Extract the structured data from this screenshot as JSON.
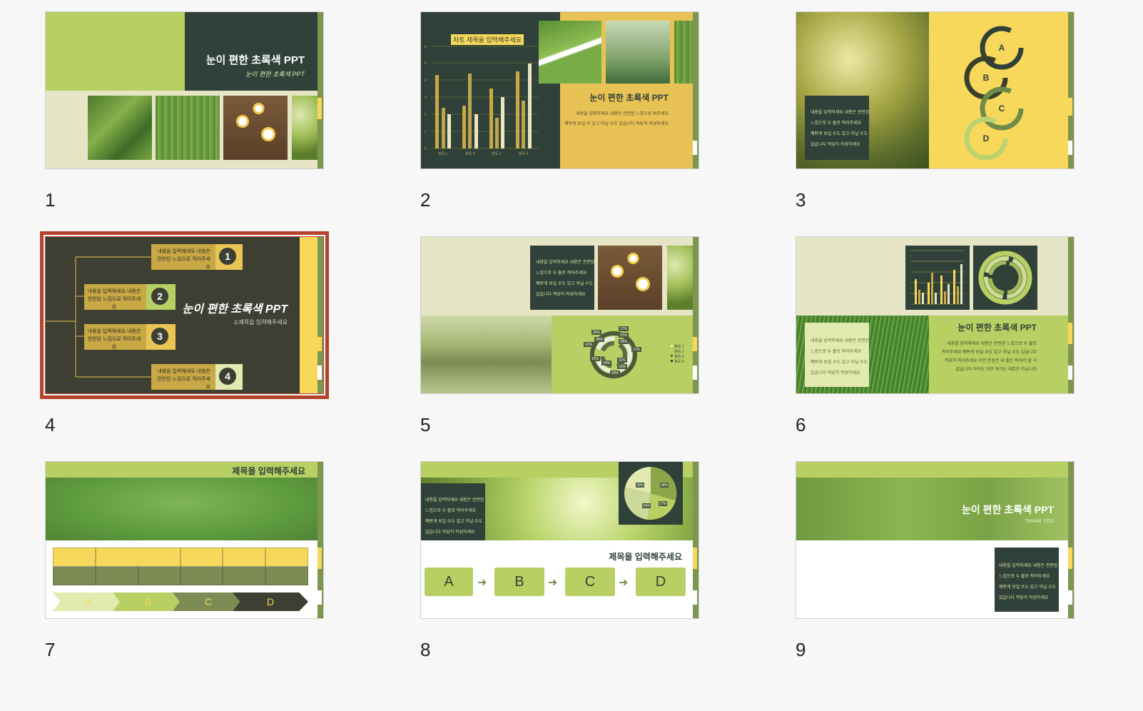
{
  "slides": [
    {
      "number": "1",
      "title": "눈이 편한 초록색 PPT",
      "subtitle": "눈이 편한 초록색 PPT"
    },
    {
      "number": "2",
      "chart_title": "차트 제목을 입력해주세요",
      "title": "눈이 편한 초록색 PPT",
      "body_lines": [
        "내용을 입력하세요 내용은 관련된 느낌으로 써주세요",
        "예쁘게 보일 수 있고 아닐 수도 있습니다 적당히 작성하세요"
      ],
      "y_ticks": [
        "6",
        "5",
        "4",
        "3",
        "2",
        "1",
        "0"
      ],
      "categories": [
        "항목 1",
        "항목 2",
        "항목 3",
        "항목 4"
      ]
    },
    {
      "number": "3",
      "cycle": [
        "A",
        "B",
        "C",
        "D"
      ],
      "body_lines": [
        "내용을 입력하세요 내용은 관련된",
        "느낌으로 두 줄로 적어주세요",
        "예쁘게 보일 수도 있고 아닐 수도",
        "있습니다 적당히 작성하세요"
      ]
    },
    {
      "number": "4",
      "title": "눈이 편한 초록색 PPT",
      "subtitle": "소제목을 입력해주세요",
      "items": [
        {
          "n": "1",
          "text": "내용을 입력해세요 내용은 관련된 느낌으로 적어주세요"
        },
        {
          "n": "2",
          "text": "내용을 입력해세요 내용은 관련된 느낌으로 적어주세요"
        },
        {
          "n": "3",
          "text": "내용을 입력해세요 내용은 관련된 느낌으로 적어주세요"
        },
        {
          "n": "4",
          "text": "내용을 입력해세요 내용은 관련된 느낌으로 적어주세요"
        }
      ]
    },
    {
      "number": "5",
      "body_lines": [
        "내용을 입력하세요 내용은 관련된",
        "느낌으로 두 줄로 적어주세요",
        "예쁘게 보일 수도 있고 아닐 수도",
        "있습니다 적당히 작성하세요"
      ],
      "donut_labels": [
        "24%",
        "30%",
        "17%",
        "21%",
        "29%",
        "17%",
        "41%",
        "16%",
        "24%",
        "11%",
        "19%",
        "25%"
      ],
      "legend": [
        "항목 1",
        "항목 2",
        "항목 3",
        "항목 4"
      ]
    },
    {
      "number": "6",
      "title": "눈이 편한 초록색 PPT",
      "body_lines": [
        "내용을 입력해세요 내용은 관련된 느낌으로 두 줄로",
        "적어주세요 예쁘게 보일 수도 있고 아닐 수도 있습니다",
        "적당히 적어주세요 이런 문장은 내 좋은 적어야 할 거",
        "같습니다 이야도 다만 여기는 대본은 아닙니다"
      ],
      "box_lines": [
        "내용을 입력하세요 내용은 관련된",
        "느낌으로 두 줄로 적어주세요",
        "예쁘게 보일 수도 있고 아닐 수도",
        "있습니다 적당히 작성하세요"
      ]
    },
    {
      "number": "7",
      "title": "제목을 입력해주세요",
      "steps": [
        "A",
        "B",
        "C",
        "D"
      ]
    },
    {
      "number": "8",
      "title": "제목을 입력해주세요",
      "steps": [
        "A",
        "B",
        "C",
        "D"
      ],
      "pie_labels": [
        "30%",
        "28%",
        "24%",
        "17%"
      ],
      "body_lines": [
        "내용을 입력하세요 내용은 관련된",
        "느낌으로 두 줄로 적어주세요",
        "예쁘게 보일 수도 있고 아닐 수도",
        "있습니다 적당히 작성하세요"
      ]
    },
    {
      "number": "9",
      "title": "눈이 편한 초록색 PPT",
      "subtitle": "THANK YOU",
      "body_lines": [
        "내용을 입력하세요 내용은 관련된",
        "느낌으로 두 줄로 적어주세요",
        "예쁘게 보일 수도 있고 아닐 수도",
        "있습니다 적당히 작성하세요"
      ]
    }
  ],
  "colors": {
    "dark": "#2f4138",
    "olive": "#b7cf63",
    "yellow": "#f7d85a",
    "cream": "#e6e5c6",
    "selection": "#b5432c"
  }
}
